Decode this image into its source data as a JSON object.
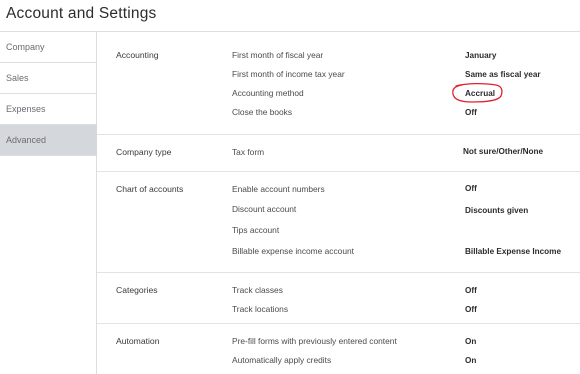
{
  "page": {
    "title": "Account and Settings"
  },
  "sidebar": {
    "items": [
      {
        "label": "Company",
        "active": false
      },
      {
        "label": "Sales",
        "active": false
      },
      {
        "label": "Expenses",
        "active": false
      },
      {
        "label": "Advanced",
        "active": true
      }
    ]
  },
  "sections": {
    "accounting": {
      "label": "Accounting",
      "rows": [
        {
          "label": "First month of fiscal year",
          "value": "January"
        },
        {
          "label": "First month of income tax year",
          "value": "Same as fiscal year"
        },
        {
          "label": "Accounting method",
          "value": "Accrual"
        },
        {
          "label": "Close the books",
          "value": "Off"
        }
      ]
    },
    "company_type": {
      "label": "Company type",
      "rows": [
        {
          "label": "Tax form",
          "value": "Not sure/Other/None"
        }
      ]
    },
    "chart_of_accounts": {
      "label": "Chart of accounts",
      "rows": [
        {
          "label": "Enable account numbers",
          "value": "Off"
        },
        {
          "label": "Discount account",
          "value": "Discounts given"
        },
        {
          "label": "Tips account",
          "value": ""
        },
        {
          "label": "Billable expense income account",
          "value": "Billable Expense Income"
        }
      ]
    },
    "categories": {
      "label": "Categories",
      "rows": [
        {
          "label": "Track classes",
          "value": "Off"
        },
        {
          "label": "Track locations",
          "value": "Off"
        }
      ]
    },
    "automation": {
      "label": "Automation",
      "rows": [
        {
          "label": "Pre-fill forms with previously entered content",
          "value": "On"
        },
        {
          "label": "Automatically apply credits",
          "value": "On"
        }
      ]
    }
  },
  "annotation": {
    "color": "#e0202e"
  }
}
